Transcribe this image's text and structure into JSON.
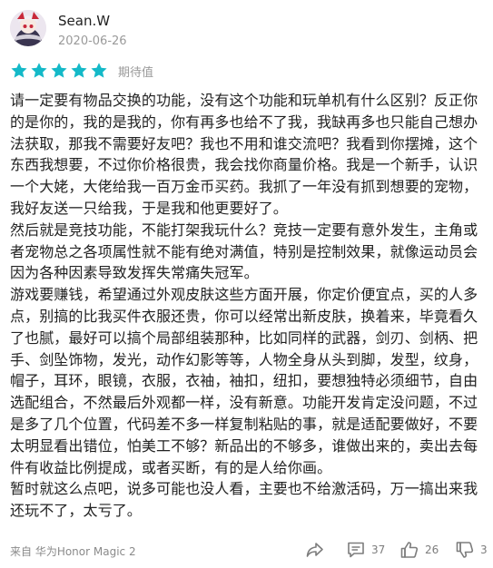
{
  "user": {
    "name": "Sean.W",
    "date": "2020-06-26",
    "avatar_icon": "avatar"
  },
  "rating": {
    "stars": 5,
    "max": 5,
    "label": "期待值",
    "color": "#14b9c8"
  },
  "review": {
    "paragraphs": [
      "请一定要有物品交换的功能，没有这个功能和玩单机有什么区别？反正你的是你的，我的是我的，你有再多也给不了我，我缺再多也只能自己想办法获取，那我不需要好友吧？我也不用和谁交流吧？我看到你摆摊，这个东西我想要，不过你价格很贵，我会找你商量价格。我是一个新手，认识一个大姥，大佬给我一百万金币买药。我抓了一年没有抓到想要的宠物，我好友送一只给我，于是我和他更要好了。",
      "然后就是竞技功能，不能打架我玩什么？竞技一定要有意外发生，主角或者宠物总之各项属性就不能有绝对满值，特别是控制效果，就像运动员会因为各种因素导致发挥失常痛失冠军。",
      "游戏要赚钱，希望通过外观皮肤这些方面开展，你定价便宜点，买的人多点，别搞的比我买件衣服还贵，你可以经常出新皮肤，换着来，毕竟看久了也腻，最好可以搞个局部组装那种，比如同样的武器，剑刃、剑柄、把手、剑坠饰物，发光，动作幻影等等，人物全身从头到脚，发型，纹身，帽子，耳环，眼镜，衣服，衣袖，袖扣，纽扣，要想独特必须细节，自由选配组合，不然最后外观都一样，没有新意。功能开发肯定没问题，不过是多了几个位置，代码差不多一样复制粘贴的事，就是适配要做好，不要太明显看出错位，怕美工不够？新品出的不够多，谁做出来的，卖出去每件有收益比例提成，或者买断，有的是人给你画。",
      "暂时就这么点吧，说多可能也没人看，主要也不给激活码，万一搞出来我还玩不了，太亏了。"
    ]
  },
  "footer": {
    "device": "来自 华为Honor Magic 2",
    "share_icon": "share-icon",
    "comment_icon": "comment-icon",
    "comment_count": "37",
    "like_icon": "thumbs-up-icon",
    "like_count": "26",
    "dislike_icon": "thumbs-down-icon",
    "dislike_count": "3",
    "icon_color": "#7d7d7d"
  }
}
